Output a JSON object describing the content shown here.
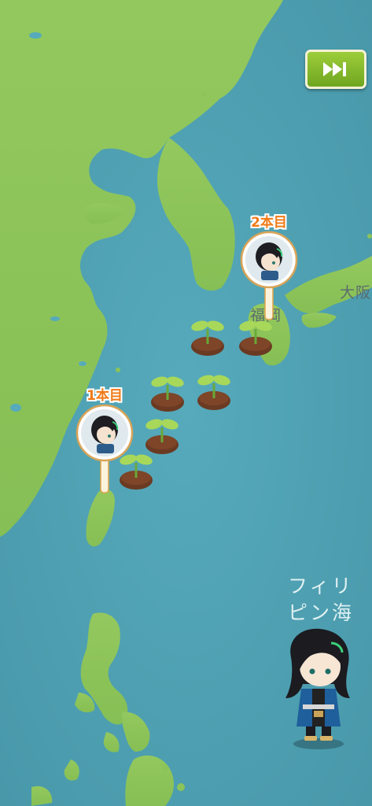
{
  "toolbar": {
    "skip_icon": "fast-forward-icon"
  },
  "map": {
    "city_labels": [
      "大阪",
      "福岡"
    ],
    "sea_label_line1": "フィリ",
    "sea_label_line2": "ピン海"
  },
  "markers": [
    {
      "count_label": "1本目"
    },
    {
      "count_label": "2本目"
    }
  ],
  "colors": {
    "sea": "#4fa3b5",
    "land": "#8cc45a",
    "accent_orange": "#f07a16",
    "button_green": "#82b82a"
  }
}
